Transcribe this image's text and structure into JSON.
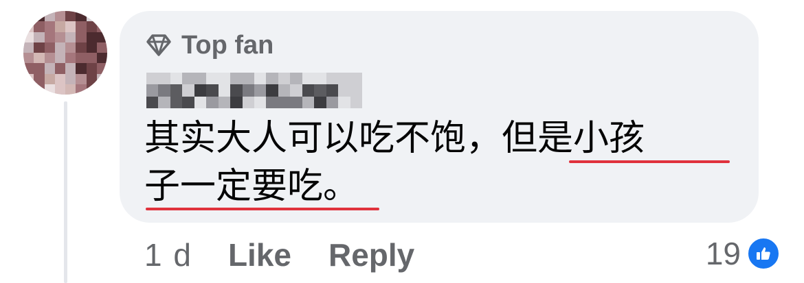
{
  "comment": {
    "badge_label": "Top fan",
    "badge_icon": "diamond-icon",
    "text_line1_plain": "其实大人可以吃不饱，",
    "text_line1_marked": "但是小孩",
    "text_line2_marked": "子一定要吃",
    "text_line2_end": "。",
    "timestamp": "1 d",
    "like_label": "Like",
    "reply_label": "Reply",
    "reaction_count": "19",
    "reaction_icon": "thumbs-up-icon"
  },
  "colors": {
    "bubble": "#f0f2f5",
    "meta_text": "#65676b",
    "body_text": "#050505",
    "underline": "#e0323c",
    "like_blue": "#1877f2"
  }
}
